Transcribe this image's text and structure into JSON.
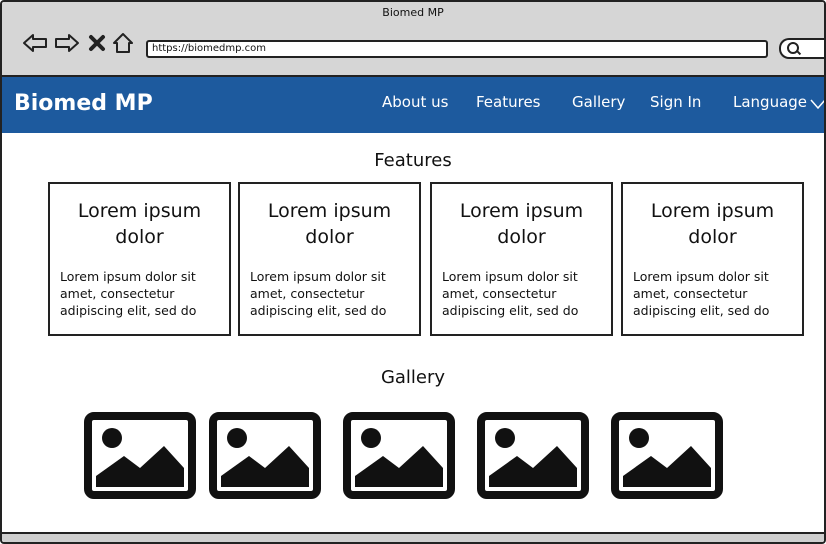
{
  "browser": {
    "window_title": "Biomed MP",
    "url": "https://biomedmp.com",
    "icons": [
      "back-arrow-icon",
      "forward-arrow-icon",
      "close-icon",
      "home-icon",
      "search-icon"
    ]
  },
  "header": {
    "brand": "Biomed MP",
    "menu": [
      {
        "label": "About us"
      },
      {
        "label": "Features"
      },
      {
        "label": "Gallery"
      },
      {
        "label": "Sign In"
      },
      {
        "label": "Language"
      }
    ],
    "bar_color": "#1d5a9e"
  },
  "features": {
    "title": "Features",
    "cards": [
      {
        "title_line1": "Lorem ipsum",
        "title_line2": "dolor",
        "body_lines": [
          "Lorem ipsum dolor sit",
          "amet, consectetur",
          "adipiscing elit, sed do"
        ]
      },
      {
        "title_line1": "Lorem ipsum",
        "title_line2": "dolor",
        "body_lines": [
          "Lorem ipsum dolor sit",
          "amet, consectetur",
          "adipiscing elit, sed do"
        ]
      },
      {
        "title_line1": "Lorem ipsum",
        "title_line2": "dolor",
        "body_lines": [
          "Lorem ipsum dolor sit",
          "amet, consectetur",
          "adipiscing elit, sed do"
        ]
      },
      {
        "title_line1": "Lorem ipsum",
        "title_line2": "dolor",
        "body_lines": [
          "Lorem ipsum dolor sit",
          "amet, consectetur",
          "adipiscing elit, sed do"
        ]
      }
    ]
  },
  "gallery": {
    "title": "Gallery",
    "images": [
      "image-placeholder-icon",
      "image-placeholder-icon",
      "image-placeholder-icon",
      "image-placeholder-icon",
      "image-placeholder-icon"
    ]
  }
}
